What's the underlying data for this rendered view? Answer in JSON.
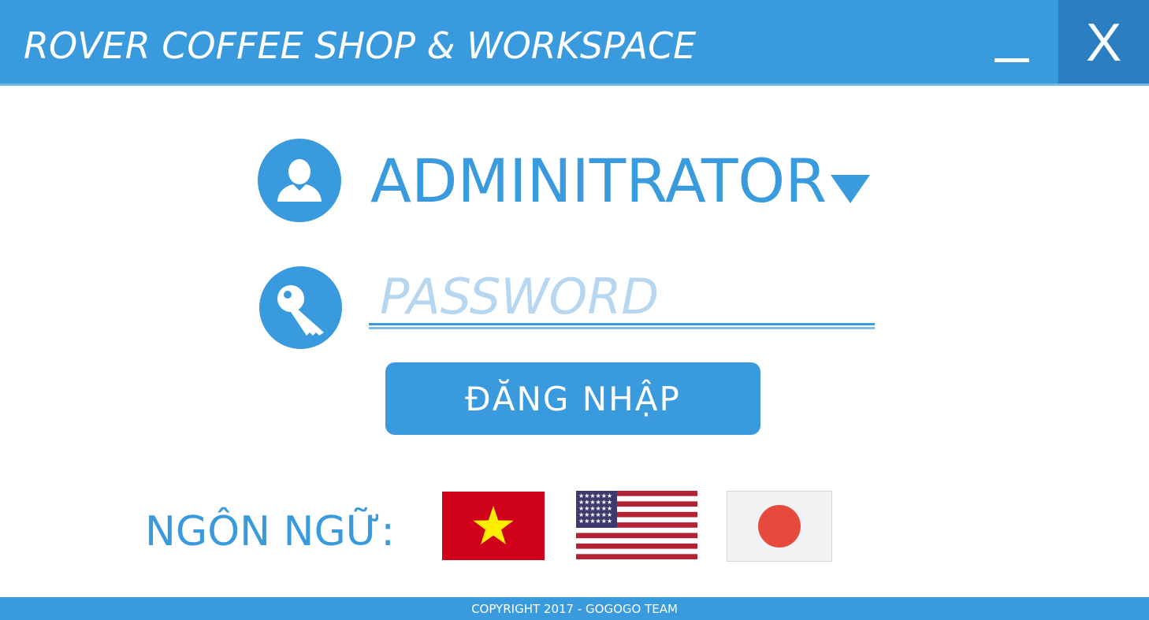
{
  "window": {
    "title": "ROVER COFFEE SHOP & WORKSPACE",
    "minimize_label": "_",
    "close_label": "X"
  },
  "login": {
    "user_select_value": "ADMINITRATOR",
    "password_placeholder": "PASSWORD",
    "login_button_label": "ĐĂNG NHẬP"
  },
  "language": {
    "label": "NGÔN NGỮ:",
    "flags": [
      "vietnam-flag",
      "usa-flag",
      "japan-flag"
    ]
  },
  "footer": {
    "copyright": "COPYRIGHT 2017 - GOGOGO TEAM"
  },
  "colors": {
    "primary": "#3a9ade",
    "close_bg": "#2b7fc0",
    "placeholder": "#b7d6ef",
    "vn_red": "#d0021b",
    "vn_star": "#ffed00",
    "us_red": "#b22234",
    "us_blue": "#3c3b6e",
    "jp_red": "#e64a3c"
  },
  "icons": {
    "user": "user-icon",
    "key": "key-icon",
    "dropdown": "dropdown-arrow-icon"
  }
}
